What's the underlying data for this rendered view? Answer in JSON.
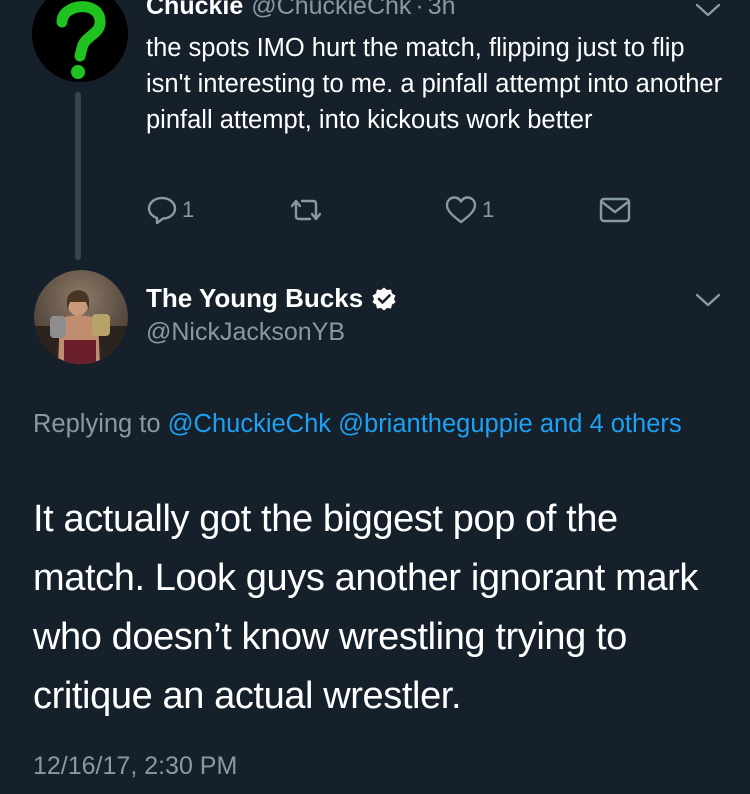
{
  "parent_tweet": {
    "name": "Chuckie",
    "handle": "@ChuckieChk",
    "separator": "·",
    "time": "3h",
    "text": "the spots IMO hurt the match, flipping just to flip isn't interesting to me.  a pinfall attempt into another pinfall attempt, into kickouts work better",
    "reply_count": "1",
    "like_count": "1",
    "avatar_icon": "green-question-mark-icon"
  },
  "main_tweet": {
    "name": "The Young Bucks",
    "handle": "@NickJacksonYB",
    "verified": true,
    "replying_prefix": "Replying to",
    "replying_links": [
      "@ChuckieChk",
      "@briantheguppie",
      "and 4 others"
    ],
    "text": "It actually got the biggest pop of the match. Look guys another ignorant mark who doesn’t know wrestling trying to critique an actual wrestler.",
    "timestamp": "12/16/17, 2:30 PM"
  },
  "colors": {
    "background": "#15202b",
    "text": "#ffffff",
    "secondary": "#8899a6",
    "link": "#1da1f2",
    "avatar_q": "#1fc21f"
  }
}
